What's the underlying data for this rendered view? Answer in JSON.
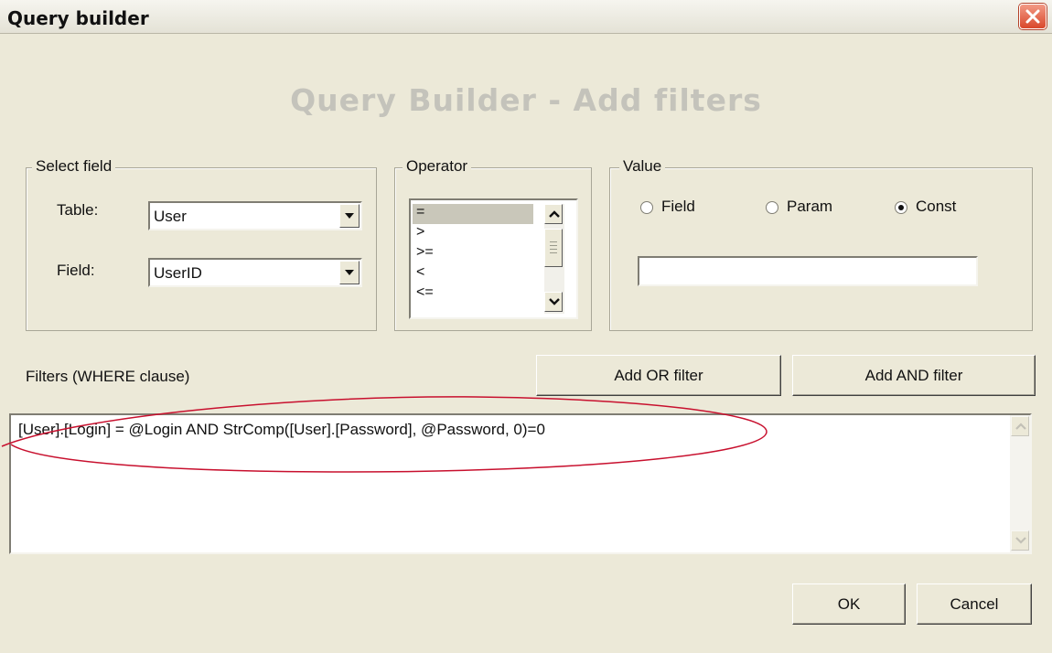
{
  "window": {
    "title": "Query builder"
  },
  "heading": "Query Builder - Add filters",
  "select_field": {
    "legend": "Select field",
    "table_label": "Table:",
    "table_value": "User",
    "field_label": "Field:",
    "field_value": "UserID"
  },
  "operator": {
    "legend": "Operator",
    "items": [
      "=",
      ">",
      ">=",
      "<",
      "<="
    ],
    "selected_index": 0
  },
  "value": {
    "legend": "Value",
    "radios": [
      {
        "label": "Field",
        "checked": false
      },
      {
        "label": "Param",
        "checked": false
      },
      {
        "label": "Const",
        "checked": true
      }
    ],
    "text": ""
  },
  "filters": {
    "label": "Filters (WHERE clause)",
    "add_or_label": "Add OR filter",
    "add_and_label": "Add AND filter",
    "text": "[User].[Login] = @Login AND StrComp([User].[Password], @Password, 0)=0"
  },
  "footer": {
    "ok_label": "OK",
    "cancel_label": "Cancel"
  },
  "colors": {
    "highlight_ellipse": "#c8102e",
    "close_button": "#d9472b",
    "dialog_bg": "#ece9d8"
  }
}
